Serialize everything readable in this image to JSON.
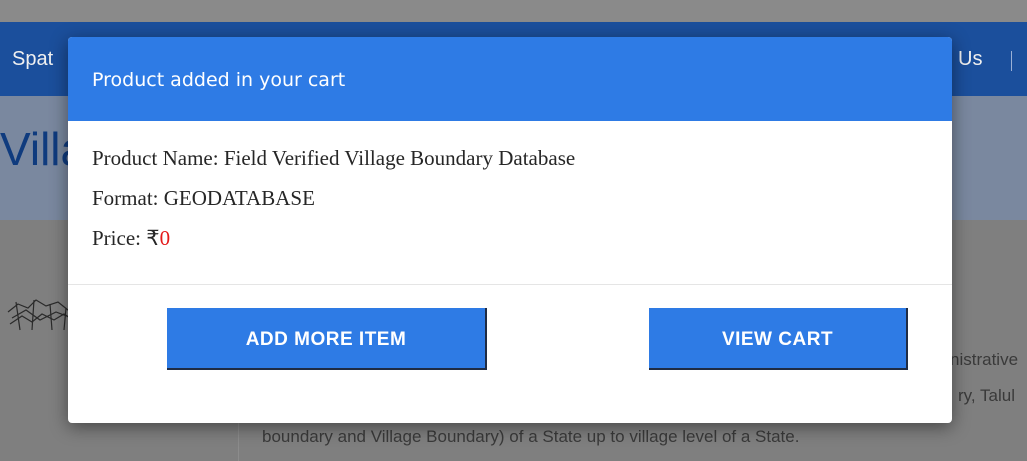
{
  "background": {
    "nav": {
      "left_text": "Spat",
      "right_text": "Us"
    },
    "page_title": "Villa",
    "content_lines": [
      "nistrative",
      "ry, Talul",
      "boundary and Village Boundary) of a State up to village level of a State."
    ]
  },
  "modal": {
    "title": "Product added in your cart",
    "product_label": "Product Name: ",
    "product_name": "Field Verified Village Boundary Database",
    "format_label": "Format: ",
    "format_value": "GEODATABASE",
    "price_label": "Price: ",
    "price_currency": "₹",
    "price_value": "0",
    "add_more_label": "ADD MORE ITEM",
    "view_cart_label": "VIEW CART"
  },
  "colors": {
    "modal_header": "#2e7be5",
    "button": "#2e7be5",
    "price": "#e41a1a",
    "navbar": "#1b4f9c"
  }
}
